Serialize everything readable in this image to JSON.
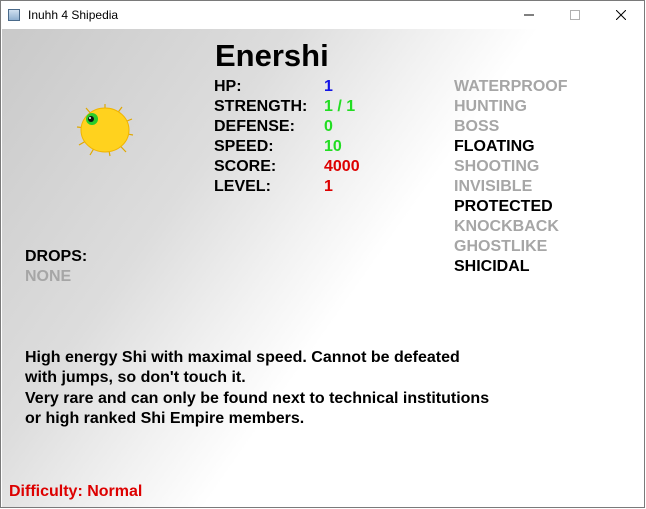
{
  "window": {
    "title": "Inuhh 4 Shipedia"
  },
  "creature": {
    "name": "Enershi",
    "stats": [
      {
        "label": "HP:",
        "value": "1",
        "color": "#1414e6"
      },
      {
        "label": "STRENGTH:",
        "value": "1 / 1",
        "color": "#22dd22"
      },
      {
        "label": "DEFENSE:",
        "value": "0",
        "color": "#22dd22"
      },
      {
        "label": "SPEED:",
        "value": "10",
        "color": "#22dd22"
      },
      {
        "label": "SCORE:",
        "value": "4000",
        "color": "#dd0000"
      },
      {
        "label": "LEVEL:",
        "value": "1",
        "color": "#dd0000"
      }
    ],
    "flags": [
      {
        "label": "WATERPROOF",
        "active": false
      },
      {
        "label": "HUNTING",
        "active": false
      },
      {
        "label": "BOSS",
        "active": false
      },
      {
        "label": "FLOATING",
        "active": true
      },
      {
        "label": "SHOOTING",
        "active": false
      },
      {
        "label": "INVISIBLE",
        "active": false
      },
      {
        "label": "PROTECTED",
        "active": true
      },
      {
        "label": "KNOCKBACK",
        "active": false
      },
      {
        "label": "GHOSTLIKE",
        "active": false
      },
      {
        "label": "SHICIDAL",
        "active": true
      }
    ],
    "drops": {
      "label": "DROPS:",
      "value": "NONE"
    },
    "description": [
      "High energy Shi with maximal speed. Cannot be defeated",
      "with jumps, so don't touch it.",
      "Very rare and can only be found next to technical institutions",
      "or high ranked Shi Empire members."
    ]
  },
  "footer": {
    "difficulty": "Difficulty: Normal"
  },
  "colors": {
    "active_flag": "#000000",
    "inactive_flag": "#a6a6a6",
    "difficulty": "#dd0000",
    "sprite_body": "#ffd21e"
  }
}
